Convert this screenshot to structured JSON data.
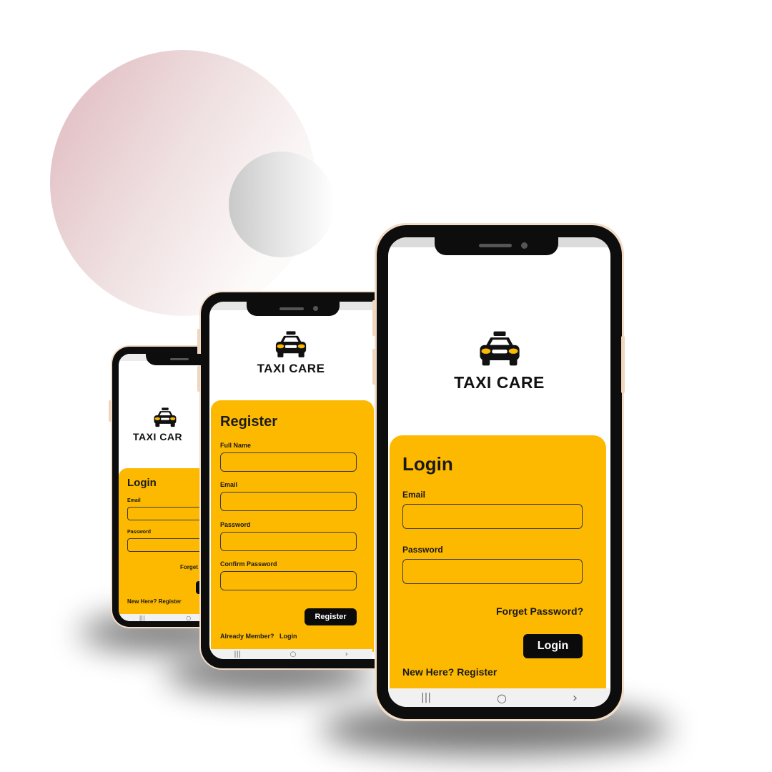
{
  "brand": {
    "name": "TAXI CARE",
    "accent": "#fdb900",
    "dark": "#0b0b0b"
  },
  "login_screen": {
    "title": "Login",
    "email_label": "Email",
    "password_label": "Password",
    "forget_password": "Forget Password?",
    "login_button": "Login",
    "new_here": "New Here?",
    "register_link": "Register"
  },
  "register_screen": {
    "title": "Register",
    "full_name_label": "Full Name",
    "email_label": "Email",
    "password_label": "Password",
    "confirm_password_label": "Confirm Password",
    "register_button": "Register",
    "already_member": "Already Member?",
    "login_link": "Login"
  },
  "small_login_screen": {
    "brand": "TAXI CAR",
    "title": "Login",
    "email_label": "Email",
    "password_label": "Password",
    "forget_password": "Forget P",
    "new_here": "New Here?",
    "register_link": "Register"
  },
  "navbar_icons": [
    "recent-apps-icon",
    "home-icon",
    "back-icon"
  ],
  "navbar_glyphs": {
    "recent": "|||",
    "home": "○",
    "back": "›"
  }
}
